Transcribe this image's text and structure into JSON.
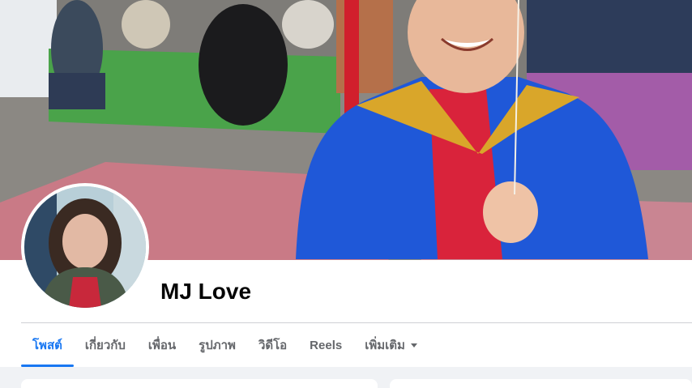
{
  "profile": {
    "name": "MJ Love"
  },
  "tabs": [
    {
      "label": "โพสต์",
      "active": true
    },
    {
      "label": "เกี่ยวกับ",
      "active": false
    },
    {
      "label": "เพื่อน",
      "active": false
    },
    {
      "label": "รูปภาพ",
      "active": false
    },
    {
      "label": "วิดีโอ",
      "active": false
    },
    {
      "label": "Reels",
      "active": false
    },
    {
      "label": "เพิ่มเติม",
      "active": false,
      "icon": "caret-down-icon"
    }
  ],
  "colors": {
    "accent": "#1877f2",
    "tab_text": "#65676b",
    "name_text": "#050505",
    "page_bg": "#f0f2f5"
  }
}
